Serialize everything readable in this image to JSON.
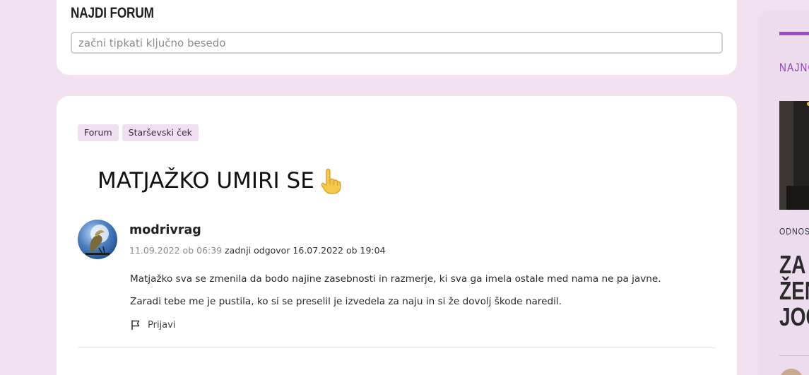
{
  "search": {
    "title": "NAJDI FORUM",
    "placeholder": "začni tipkati ključno besedo",
    "value": ""
  },
  "post": {
    "tags": [
      {
        "label": "Forum"
      },
      {
        "label": "Starševski ček"
      }
    ],
    "title": "MATJAŽKO UMIRI SE",
    "title_icon": "pointing-up-hand-icon",
    "author": "modrivrag",
    "posted": "11.09.2022 ob 06:39",
    "last_reply": "zadnji odgovor 16.07.2022 ob 19:04",
    "paragraphs": [
      "Matjažko sva se zmenila da bodo najine zasebnosti in razmerje, ki sva ga imela ostale med nama ne pa javne.",
      "Zaradi tebe me je pustila, ko si se preselil je izvedela za naju in si že dovolj škode naredil."
    ],
    "report_label": "Prijavi",
    "report_icon": "flag-icon"
  },
  "sidebar": {
    "heading": "NAJNO",
    "category": "ODNOS",
    "headline": "ZA T\nŽEN\nJOČ"
  },
  "colors": {
    "page_background": "#f2e2f1",
    "accent": "#9b4fc4",
    "tag_background": "#f0dff0",
    "card": "#ffffff"
  }
}
